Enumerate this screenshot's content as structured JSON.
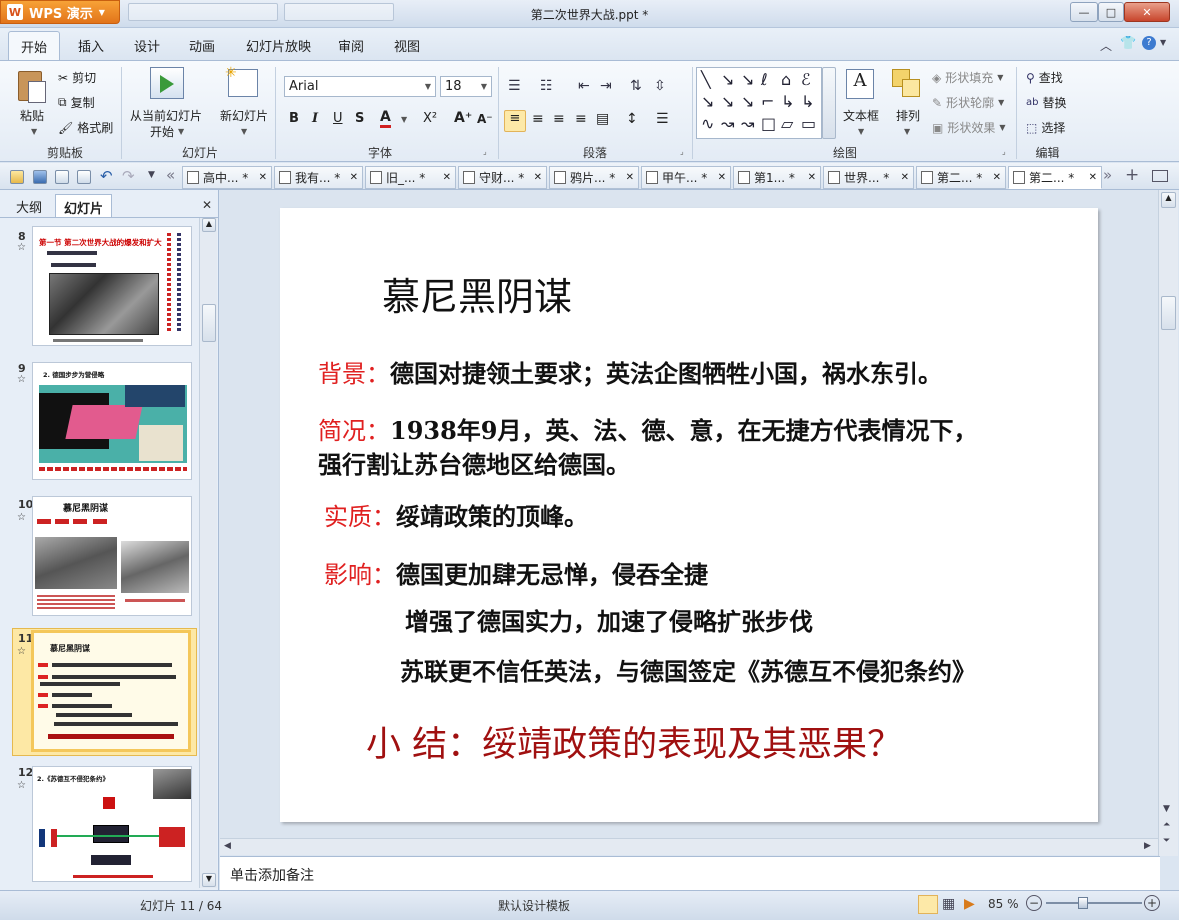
{
  "app": {
    "name": "WPS 演示",
    "title": "第二次世界大战.ppt *"
  },
  "window_controls": {
    "minimize": "—",
    "maximize": "□",
    "close": "✕"
  },
  "menu": {
    "tabs": [
      "开始",
      "插入",
      "设计",
      "动画",
      "幻灯片放映",
      "审阅",
      "视图"
    ],
    "active": "开始"
  },
  "ribbon": {
    "clipboard": {
      "paste": "粘贴",
      "cut": "剪切",
      "copy": "复制",
      "format_painter": "格式刷",
      "label": "剪贴板"
    },
    "slides": {
      "from_current": "从当前幻灯片",
      "start": "开始",
      "new_slide": "新幻灯片",
      "label": "幻灯片"
    },
    "font": {
      "name": "Arial",
      "size": "18",
      "bold": "B",
      "italic": "I",
      "underline": "U",
      "shadow": "S",
      "color": "A",
      "superscript": "X²",
      "grow": "A⁺",
      "shrink": "A⁻",
      "label": "字体"
    },
    "paragraph": {
      "label": "段落"
    },
    "drawing": {
      "textbox": "文本框",
      "arrange": "排列",
      "shape_fill": "形状填充",
      "shape_outline": "形状轮廓",
      "shape_effect": "形状效果",
      "label": "绘图"
    },
    "editing": {
      "find": "查找",
      "replace": "替换",
      "select": "选择",
      "label": "编辑"
    }
  },
  "doc_tabs": [
    {
      "label": "高中...  *"
    },
    {
      "label": "我有...  *"
    },
    {
      "label": "旧_...  *"
    },
    {
      "label": "守财...  *"
    },
    {
      "label": "鸦片...  *"
    },
    {
      "label": "甲午...  *"
    },
    {
      "label": "第1...  *"
    },
    {
      "label": "世界...  *"
    },
    {
      "label": "第二...  *"
    },
    {
      "label": "第二...  *",
      "active": true
    }
  ],
  "left_panel": {
    "tabs": [
      "大纲",
      "幻灯片"
    ],
    "active_tab": "幻灯片",
    "close": "✕",
    "thumbnails": [
      {
        "number": "8",
        "title": "第一节 第二次世界大战的爆发和扩大"
      },
      {
        "number": "9",
        "title": "2. 德国步步为营侵略"
      },
      {
        "number": "10",
        "title": "慕尼黑阴谋"
      },
      {
        "number": "11",
        "title": "慕尼黑阴谋",
        "selected": true
      },
      {
        "number": "12",
        "title": "2.《苏德互不侵犯条约》"
      }
    ],
    "star": "☆"
  },
  "slide": {
    "title": "慕尼黑阴谋",
    "background_label": "背景：",
    "background_text": "德国对捷领土要求；英法企图牺牲小国，祸水东引。",
    "situation_label": "简况：",
    "situation_line1": "1938年9月，英、法、德、意，在无捷方代表情况下，",
    "situation_line2": "强行割让苏台德地区给德国。",
    "essence_label": "实质：",
    "essence_text": "绥靖政策的顶峰。",
    "impact_label": "影响：",
    "impact_1": "德国更加肆无忌惮，侵吞全捷",
    "impact_2": "增强了德国实力，加速了侵略扩张步伐",
    "impact_3": "苏联更不信任英法，与德国签定《苏德互不侵犯条约》",
    "summary": "小 结：绥靖政策的表现及其恶果？"
  },
  "notes": {
    "placeholder": "单击添加备注"
  },
  "status": {
    "slide_counter": "幻灯片 11 / 64",
    "template": "默认设计模板",
    "zoom": "85 %"
  },
  "colors": {
    "label_red": "#e02020",
    "summary_red": "#a01010",
    "accent": "#e2741a"
  }
}
